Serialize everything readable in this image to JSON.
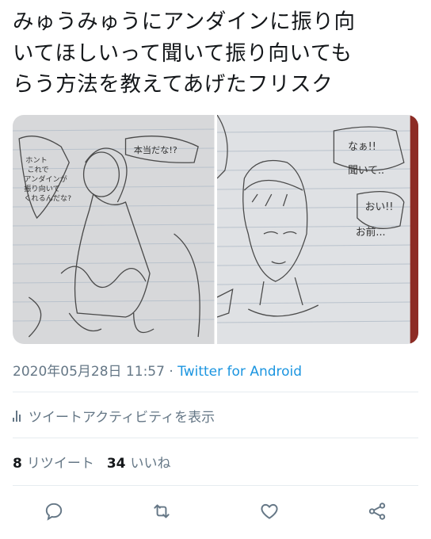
{
  "tweet": {
    "text": "みゅうみゅうにアンダインに振り向\nいてほしいって聞いて振り向いても\nらう方法を教えてあげたフリスク"
  },
  "media": {
    "left_image_texts": [
      "本当だな!?",
      "ホント\nこれで\nアンダインが\n振り向いて\nくれるんだな?"
    ],
    "right_image_texts": [
      "なぁ!!",
      "聞いて..",
      "おい!!",
      "お前..."
    ]
  },
  "meta": {
    "datetime": "2020年05月28日 11:57",
    "separator": " · ",
    "source": "Twitter for Android"
  },
  "activity": {
    "label": "ツイートアクティビティを表示"
  },
  "stats": {
    "retweets_count": "8",
    "retweets_label": "リツイート",
    "likes_count": "34",
    "likes_label": "いいね"
  },
  "colors": {
    "text": "#14171a",
    "secondary": "#657786",
    "link": "#1b95e0",
    "divider": "#e6ecf0"
  },
  "icons": {
    "reply": "reply-icon",
    "retweet": "retweet-icon",
    "like": "like-icon",
    "share": "share-icon",
    "activity": "bar-chart-icon"
  }
}
